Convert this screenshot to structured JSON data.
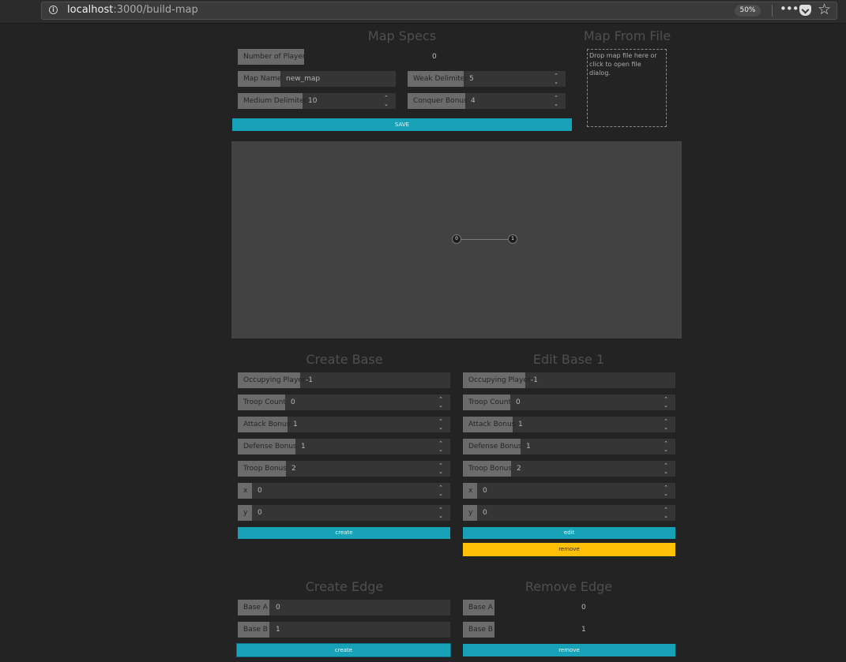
{
  "browser": {
    "url_host": "localhost",
    "url_path": ":3000/build-map",
    "zoom": "50%",
    "more_icon": "more-icon",
    "pocket_icon": "pocket-icon",
    "star_icon": "star-icon"
  },
  "map_specs": {
    "title": "Map Specs",
    "num_players_label": "Number of Players",
    "num_players_value": "0",
    "map_name_label": "Map Name",
    "map_name_value": "new_map",
    "weak_label": "Weak Delimiter",
    "weak_value": "5",
    "medium_label": "Medium Delimiter",
    "medium_value": "10",
    "conquer_label": "Conquer Bonus",
    "conquer_value": "4",
    "save_label": "SAVE"
  },
  "map_file": {
    "title": "Map From File",
    "drop_text": "Drop map file here or click to open file dialog."
  },
  "graph": {
    "nodes": [
      {
        "label": "0"
      },
      {
        "label": "1"
      }
    ]
  },
  "create_base": {
    "title": "Create Base",
    "fields": [
      {
        "label": "Occupying Player",
        "value": "-1"
      },
      {
        "label": "Troop Count",
        "value": "0"
      },
      {
        "label": "Attack Bonus",
        "value": "1"
      },
      {
        "label": "Defense Bonus",
        "value": "1"
      },
      {
        "label": "Troop Bonus",
        "value": "2"
      },
      {
        "label": "x",
        "value": "0"
      },
      {
        "label": "y",
        "value": "0"
      }
    ],
    "create_label": "create"
  },
  "edit_base": {
    "title": "Edit Base 1",
    "fields": [
      {
        "label": "Occupying Player",
        "value": "-1"
      },
      {
        "label": "Troop Count",
        "value": "0"
      },
      {
        "label": "Attack Bonus",
        "value": "1"
      },
      {
        "label": "Defense Bonus",
        "value": "1"
      },
      {
        "label": "Troop Bonus",
        "value": "2"
      },
      {
        "label": "x",
        "value": "0"
      },
      {
        "label": "y",
        "value": "0"
      }
    ],
    "edit_label": "edit",
    "remove_label": "remove"
  },
  "create_edge": {
    "title": "Create Edge",
    "base_a_label": "Base A",
    "base_a_value": "0",
    "base_b_label": "Base B",
    "base_b_value": "1",
    "create_label": "create"
  },
  "remove_edge": {
    "title": "Remove Edge",
    "base_a_label": "Base A",
    "base_a_value": "0",
    "base_b_label": "Base B",
    "base_b_value": "1",
    "remove_label": "remove"
  },
  "colors": {
    "primary": "#17a2b8",
    "warning": "#ffc107",
    "background": "#232323"
  }
}
